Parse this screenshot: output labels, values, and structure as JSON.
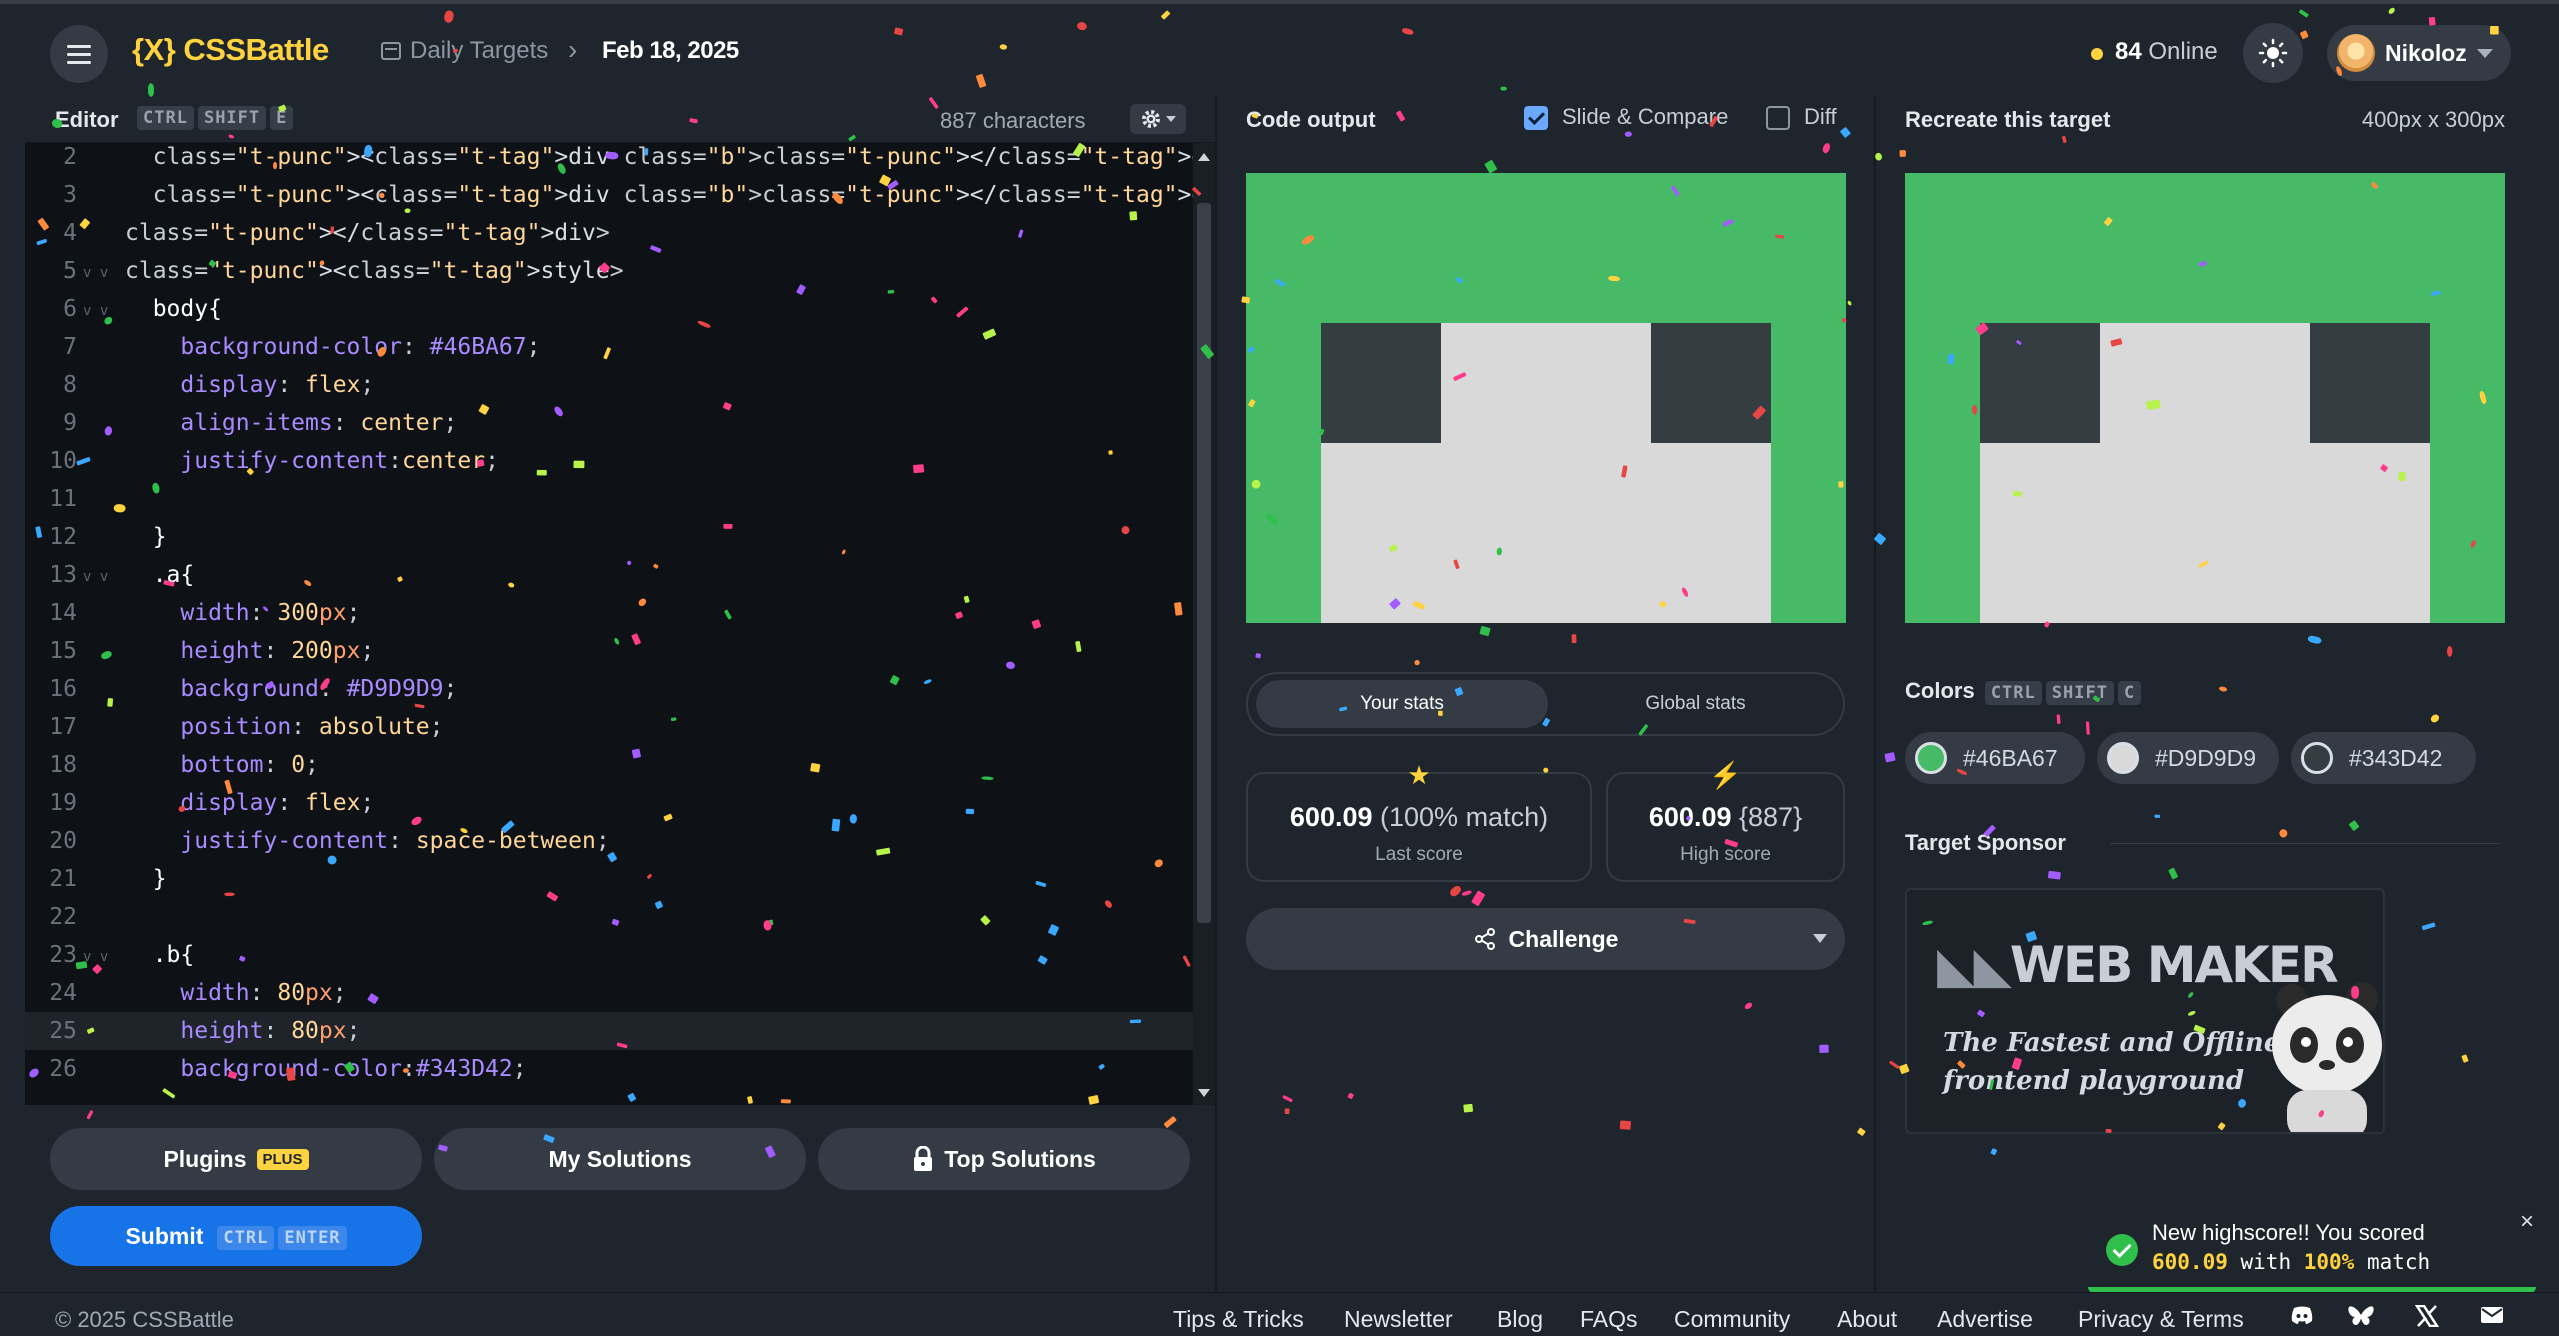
{
  "brand": {
    "logo_mark": "{X}",
    "name": "CSSBattle"
  },
  "breadcrumb": {
    "section": "Daily Targets",
    "date": "Feb 18, 2025"
  },
  "header": {
    "online_count": "84",
    "online_label": "Online",
    "user_name": "Nikoloz"
  },
  "editor": {
    "title": "Editor",
    "shortcut": [
      "CTRL",
      "SHIFT",
      "E"
    ],
    "char_count": "887 characters",
    "active_line": 25,
    "lines": [
      {
        "n": "2",
        "fold": "",
        "code": "  <div class=\"b\"></div>"
      },
      {
        "n": "3",
        "fold": "",
        "code": "  <div class=\"b\"></div>"
      },
      {
        "n": "4",
        "fold": "",
        "code": "</div>"
      },
      {
        "n": "5",
        "fold": "v v",
        "code": "<style>"
      },
      {
        "n": "6",
        "fold": "v v",
        "code": "  body{"
      },
      {
        "n": "7",
        "fold": "",
        "code": "    background-color: #46BA67;"
      },
      {
        "n": "8",
        "fold": "",
        "code": "    display: flex;"
      },
      {
        "n": "9",
        "fold": "",
        "code": "    align-items: center;"
      },
      {
        "n": "10",
        "fold": "",
        "code": "    justify-content:center;"
      },
      {
        "n": "11",
        "fold": "",
        "code": ""
      },
      {
        "n": "12",
        "fold": "",
        "code": "  }"
      },
      {
        "n": "13",
        "fold": "v v",
        "code": "  .a{"
      },
      {
        "n": "14",
        "fold": "",
        "code": "    width: 300px;"
      },
      {
        "n": "15",
        "fold": "",
        "code": "    height: 200px;"
      },
      {
        "n": "16",
        "fold": "",
        "code": "    background: #D9D9D9;"
      },
      {
        "n": "17",
        "fold": "",
        "code": "    position: absolute;"
      },
      {
        "n": "18",
        "fold": "",
        "code": "    bottom: 0;"
      },
      {
        "n": "19",
        "fold": "",
        "code": "    display: flex;"
      },
      {
        "n": "20",
        "fold": "",
        "code": "    justify-content: space-between;"
      },
      {
        "n": "21",
        "fold": "",
        "code": "  }"
      },
      {
        "n": "22",
        "fold": "",
        "code": ""
      },
      {
        "n": "23",
        "fold": "v v",
        "code": "  .b{"
      },
      {
        "n": "24",
        "fold": "",
        "code": "    width: 80px;"
      },
      {
        "n": "25",
        "fold": "",
        "code": "    height: 80px;"
      },
      {
        "n": "26",
        "fold": "",
        "code": "    background-color:#343D42;"
      }
    ]
  },
  "actions": {
    "plugins_label": "Plugins",
    "plugins_badge": "PLUS",
    "my_solutions_label": "My Solutions",
    "top_solutions_label": "Top Solutions",
    "submit_label": "Submit",
    "submit_keys": [
      "CTRL",
      "ENTER"
    ]
  },
  "output": {
    "title": "Code output",
    "slide_compare_label": "Slide & Compare",
    "slide_compare_checked": true,
    "diff_label": "Diff",
    "diff_checked": false
  },
  "stats": {
    "tab_yours": "Your stats",
    "tab_global": "Global stats",
    "last_score": "600.09",
    "last_match": "(100% match)",
    "last_label": "Last score",
    "high_score": "600.09",
    "high_chars": "{887}",
    "high_label": "High score",
    "challenge_label": "Challenge"
  },
  "target": {
    "title": "Recreate this target",
    "size": "400px x 300px",
    "colors_title": "Colors",
    "colors_keys": [
      "CTRL",
      "SHIFT",
      "C"
    ],
    "colors": [
      "#46BA67",
      "#D9D9D9",
      "#343D42"
    ],
    "sponsor_title": "Target Sponsor",
    "sponsor_name": "WEB MAKER",
    "sponsor_tagline_1": "The Fastest and Offline",
    "sponsor_tagline_2": "frontend playground"
  },
  "toast": {
    "line1": "New highscore!! You scored",
    "score": "600.09",
    "with": "with",
    "match": "100%",
    "match_word": "match",
    "close": "×"
  },
  "footer": {
    "copyright": "© 2025 CSSBattle",
    "links": [
      "Tips & Tricks",
      "Newsletter",
      "Blog",
      "FAQs",
      "Community",
      "About",
      "Advertise",
      "Privacy & Terms"
    ]
  }
}
